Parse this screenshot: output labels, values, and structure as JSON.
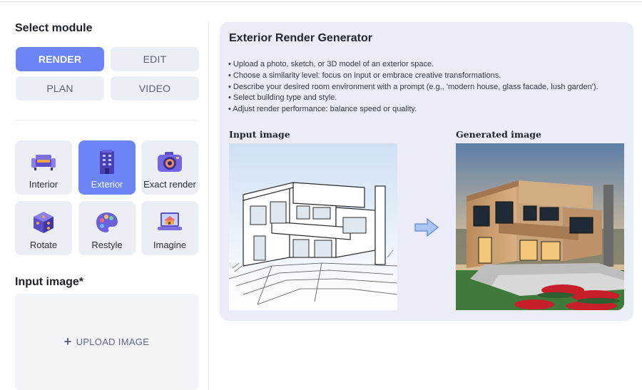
{
  "sidebar": {
    "select_module_title": "Select module",
    "modules": [
      {
        "label": "RENDER",
        "active": true
      },
      {
        "label": "EDIT",
        "active": false
      },
      {
        "label": "PLAN",
        "active": false
      },
      {
        "label": "VIDEO",
        "active": false
      }
    ],
    "tools": [
      {
        "label": "Interior",
        "icon": "sofa-icon",
        "active": false
      },
      {
        "label": "Exterior",
        "icon": "building-icon",
        "active": true
      },
      {
        "label": "Exact render",
        "icon": "camera-icon",
        "active": false
      },
      {
        "label": "Rotate",
        "icon": "cube-icon",
        "active": false
      },
      {
        "label": "Restyle",
        "icon": "palette-icon",
        "active": false
      },
      {
        "label": "Imagine",
        "icon": "laptop-house-icon",
        "active": false
      }
    ],
    "input_image_title": "Input image*",
    "upload_label": "UPLOAD IMAGE"
  },
  "info_card": {
    "title": "Exterior Render Generator",
    "bullets": [
      "• Upload a photo, sketch, or 3D model of an exterior space.",
      "• Choose a similarity level: focus on input or embrace creative transformations.",
      "• Describe your desired room environment with a prompt (e.g., 'modern house, glass facade, lush garden').",
      "• Select building type and style.",
      "• Adjust render performance: balance speed or quality."
    ],
    "input_image_label": "Input image",
    "generated_image_label": "Generated image"
  },
  "colors": {
    "accent": "#6b86f4",
    "button_bg": "#eceef5",
    "card_bg": "#eaedf7"
  }
}
